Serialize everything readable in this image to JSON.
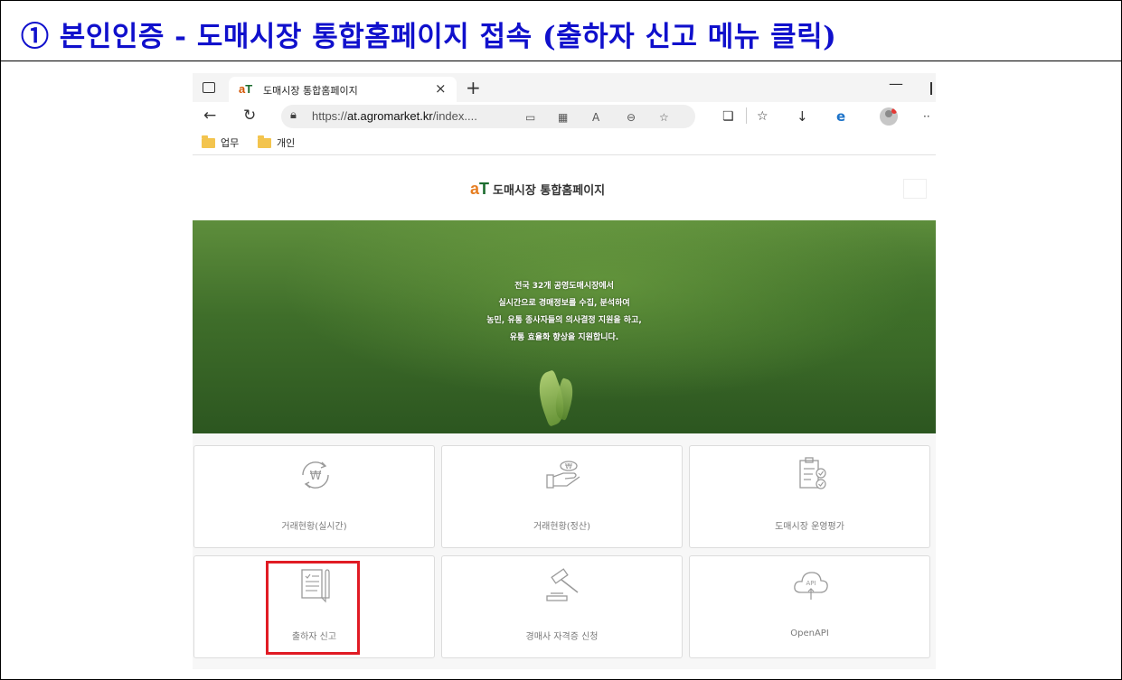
{
  "step": {
    "title": "① 본인인증 - 도매시장 통합홈페이지 접속 (출하자 신고 메뉴 클릭)"
  },
  "browser": {
    "tab_title": "도매시장 통합홈페이지",
    "tab_close": "×",
    "new_tab": "+",
    "minimize": "—",
    "url_prefix": "https://",
    "url_host": "at.agromarket.kr",
    "url_rest": "/index....",
    "bookmarks": [
      "업무",
      "개인"
    ]
  },
  "site": {
    "logo_mark_a": "a",
    "logo_mark_t": "T",
    "name": "도매시장 통합홈페이지",
    "hero_lines": [
      "전국 32개 공영도매시장에서",
      "실시간으로 경매정보를 수집, 분석하여",
      "농민, 유통 종사자들의 의사결정 지원을 하고,",
      "유통 효율화 향상을 지원합니다."
    ]
  },
  "menu_cards": [
    {
      "label": "거래현황(실시간)",
      "icon": "won-refresh-icon"
    },
    {
      "label": "거래현황(정산)",
      "icon": "hand-money-icon"
    },
    {
      "label": "도매시장 운영평가",
      "icon": "clipboard-check-icon"
    },
    {
      "label": "출하자 신고",
      "icon": "document-pen-icon"
    },
    {
      "label": "경매사 자격증 신청",
      "icon": "gavel-icon"
    },
    {
      "label": "OpenAPI",
      "icon": "cloud-api-icon",
      "icon_text": "API"
    }
  ],
  "colors": {
    "title_blue": "#1010cc",
    "highlight_red": "#e01b24",
    "brand_green": "#1b6c2e",
    "brand_orange": "#e67e22"
  }
}
